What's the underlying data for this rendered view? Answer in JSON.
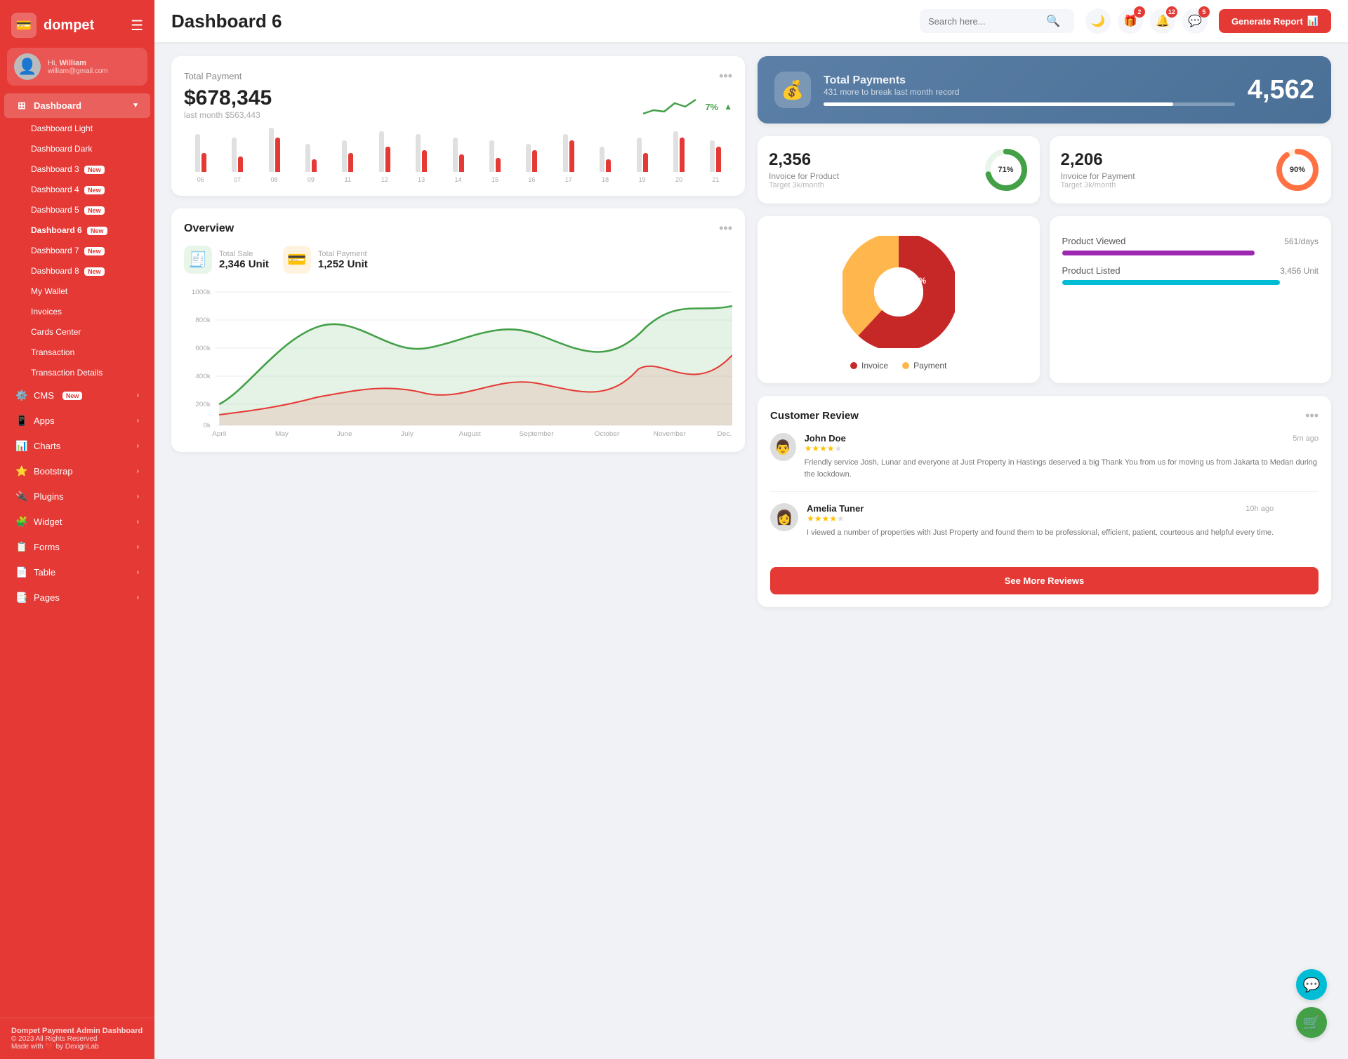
{
  "sidebar": {
    "logo": "dompet",
    "logo_icon": "💳",
    "user": {
      "hi": "Hi,",
      "name": "William",
      "email": "william@gmail.com"
    },
    "nav_main": "Dashboard",
    "nav_items": [
      {
        "label": "Dashboard Light",
        "sub": true
      },
      {
        "label": "Dashboard Dark",
        "sub": true
      },
      {
        "label": "Dashboard 3",
        "sub": true,
        "badge": "New"
      },
      {
        "label": "Dashboard 4",
        "sub": true,
        "badge": "New"
      },
      {
        "label": "Dashboard 5",
        "sub": true,
        "badge": "New"
      },
      {
        "label": "Dashboard 6",
        "sub": true,
        "badge": "New",
        "active": true
      },
      {
        "label": "Dashboard 7",
        "sub": true,
        "badge": "New"
      },
      {
        "label": "Dashboard 8",
        "sub": true,
        "badge": "New"
      },
      {
        "label": "My Wallet",
        "sub": true
      },
      {
        "label": "Invoices",
        "sub": true
      },
      {
        "label": "Cards Center",
        "sub": true
      },
      {
        "label": "Transaction",
        "sub": true
      },
      {
        "label": "Transaction Details",
        "sub": true
      }
    ],
    "menu_items": [
      {
        "label": "CMS",
        "icon": "⚙️",
        "badge": "New",
        "arrow": true
      },
      {
        "label": "Apps",
        "icon": "📱",
        "arrow": true
      },
      {
        "label": "Charts",
        "icon": "📊",
        "arrow": true
      },
      {
        "label": "Bootstrap",
        "icon": "⭐",
        "arrow": true
      },
      {
        "label": "Plugins",
        "icon": "🔌",
        "arrow": true
      },
      {
        "label": "Widget",
        "icon": "🧩",
        "arrow": true
      },
      {
        "label": "Forms",
        "icon": "📋",
        "arrow": true
      },
      {
        "label": "Table",
        "icon": "📄",
        "arrow": true
      },
      {
        "label": "Pages",
        "icon": "📑",
        "arrow": true
      }
    ],
    "footer": {
      "title": "Dompet Payment Admin Dashboard",
      "copy": "© 2023 All Rights Reserved",
      "made": "Made with ❤️ by DexignLab"
    }
  },
  "header": {
    "title": "Dashboard 6",
    "search_placeholder": "Search here...",
    "icons": [
      {
        "name": "moon-icon",
        "symbol": "🌙"
      },
      {
        "name": "gift-icon",
        "symbol": "🎁",
        "badge": 2
      },
      {
        "name": "bell-icon",
        "symbol": "🔔",
        "badge": 12
      },
      {
        "name": "chat-icon",
        "symbol": "💬",
        "badge": 5
      }
    ],
    "generate_btn": "Generate Report"
  },
  "total_payment": {
    "label": "Total Payment",
    "amount": "$678,345",
    "last_month": "last month $563,443",
    "trend_pct": "7%",
    "bars": [
      {
        "label": "06",
        "gray": 60,
        "red": 30
      },
      {
        "label": "07",
        "gray": 55,
        "red": 25
      },
      {
        "label": "08",
        "gray": 70,
        "red": 55
      },
      {
        "label": "09",
        "gray": 45,
        "red": 20
      },
      {
        "label": "11",
        "gray": 50,
        "red": 30
      },
      {
        "label": "12",
        "gray": 65,
        "red": 40
      },
      {
        "label": "13",
        "gray": 60,
        "red": 35
      },
      {
        "label": "14",
        "gray": 55,
        "red": 28
      },
      {
        "label": "15",
        "gray": 50,
        "red": 22
      },
      {
        "label": "16",
        "gray": 45,
        "red": 35
      },
      {
        "label": "17",
        "gray": 60,
        "red": 50
      },
      {
        "label": "18",
        "gray": 40,
        "red": 20
      },
      {
        "label": "19",
        "gray": 55,
        "red": 30
      },
      {
        "label": "20",
        "gray": 65,
        "red": 55
      },
      {
        "label": "21",
        "gray": 50,
        "red": 40
      }
    ]
  },
  "total_payments_blue": {
    "title": "Total Payments",
    "sub": "431 more to break last month record",
    "number": "4,562",
    "progress": 85
  },
  "invoice_product": {
    "number": "2,356",
    "label": "Invoice for Product",
    "target": "Target 3k/month",
    "pct": 71,
    "color": "#43a047"
  },
  "invoice_payment": {
    "number": "2,206",
    "label": "Invoice for Payment",
    "target": "Target 3k/month",
    "pct": 90,
    "color": "#ff7043"
  },
  "overview": {
    "title": "Overview",
    "total_sale_label": "Total Sale",
    "total_sale_value": "2,346 Unit",
    "total_payment_label": "Total Payment",
    "total_payment_value": "1,252 Unit",
    "months": [
      "April",
      "May",
      "June",
      "July",
      "August",
      "September",
      "October",
      "November",
      "Dec."
    ],
    "y_labels": [
      "1000k",
      "800k",
      "600k",
      "400k",
      "200k",
      "0k"
    ]
  },
  "pie": {
    "invoice_pct": 62,
    "payment_pct": 38,
    "invoice_label": "Invoice",
    "payment_label": "Payment",
    "invoice_color": "#c62828",
    "payment_color": "#ffb74d"
  },
  "product_viewed": {
    "label": "Product Viewed",
    "value": "561/days",
    "pct": 75
  },
  "product_listed": {
    "label": "Product Listed",
    "value": "3,456 Unit",
    "pct": 85
  },
  "reviews": {
    "title": "Customer Review",
    "items": [
      {
        "name": "John Doe",
        "time": "5m ago",
        "stars": 4,
        "text": "Friendly service Josh, Lunar and everyone at Just Property in Hastings deserved a big Thank You from us for moving us from Jakarta to Medan during the lockdown."
      },
      {
        "name": "Amelia Tuner",
        "time": "10h ago",
        "stars": 4,
        "text": "I viewed a number of properties with Just Property and found them to be professional, efficient, patient, courteous and helpful every time."
      }
    ],
    "see_more": "See More Reviews"
  },
  "floating": {
    "support": "💬",
    "cart": "🛒"
  }
}
